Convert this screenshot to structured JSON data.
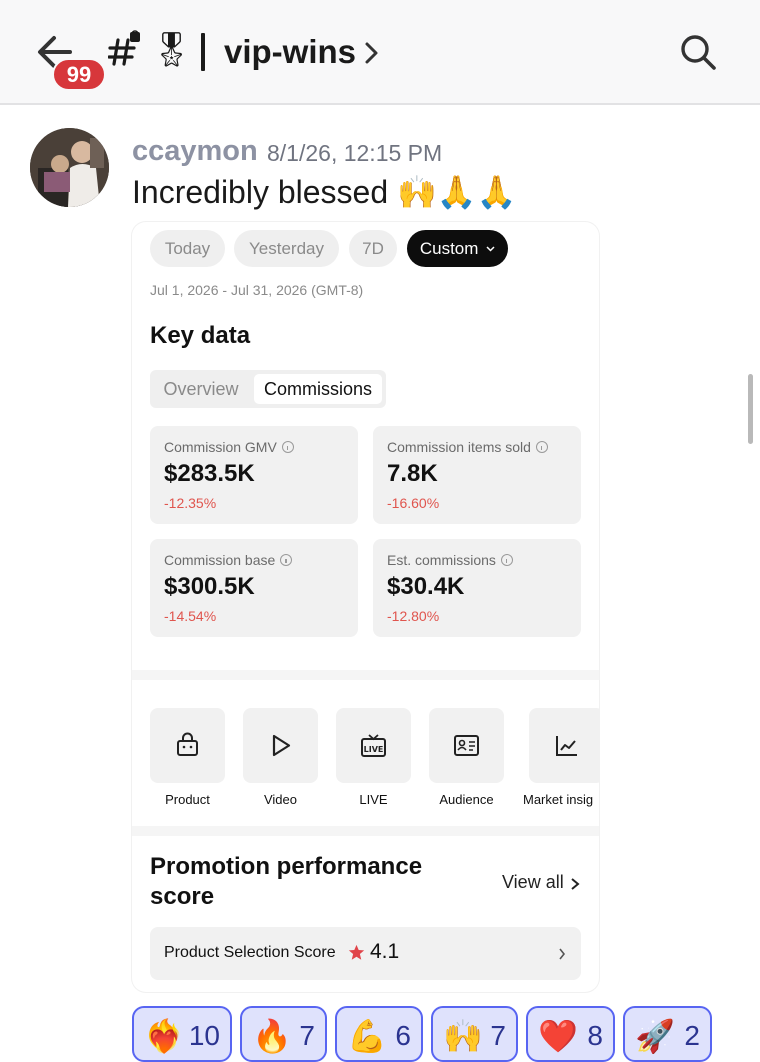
{
  "header": {
    "unread_count": "99",
    "channel_emoji": "🎖",
    "channel_name": "vip-wins",
    "icons": [
      "back-arrow-icon",
      "channel-hash-icon",
      "chevron-right-icon",
      "search-icon"
    ]
  },
  "message": {
    "username": "ccaymon",
    "timestamp": "8/1/26, 12:15 PM",
    "text": "Incredibly blessed 🙌🙏🙏"
  },
  "card": {
    "filters": [
      "Today",
      "Yesterday",
      "7D",
      "Custom"
    ],
    "selected_filter": "Custom",
    "date_range": "Jul 1, 2026 - Jul 31, 2026 (GMT-8)",
    "key_data_title": "Key data",
    "segments": [
      "Overview",
      "Commissions"
    ],
    "selected_segment": "Commissions",
    "stats": [
      {
        "label": "Commission GMV",
        "value": "$283.5K",
        "change": "-12.35%"
      },
      {
        "label": "Commission items sold",
        "value": "7.8K",
        "change": "-16.60%"
      },
      {
        "label": "Commission base",
        "value": "$300.5K",
        "change": "-14.54%"
      },
      {
        "label": "Est. commissions",
        "value": "$30.4K",
        "change": "-12.80%"
      }
    ],
    "tools": [
      {
        "label": "Product",
        "icon": "shopping-bag-icon"
      },
      {
        "label": "Video",
        "icon": "play-icon"
      },
      {
        "label": "LIVE",
        "icon": "live-tv-icon"
      },
      {
        "label": "Audience",
        "icon": "id-card-icon"
      },
      {
        "label": "Market insig",
        "icon": "line-chart-icon"
      }
    ],
    "promo_title": "Promotion performance score",
    "view_all": "View all",
    "score_label": "Product Selection Score",
    "score_value": "4.1"
  },
  "reactions": [
    {
      "emoji": "❤️‍🔥",
      "count": "10"
    },
    {
      "emoji": "🔥",
      "count": "7"
    },
    {
      "emoji": "💪",
      "count": "6"
    },
    {
      "emoji": "🙌",
      "count": "7"
    },
    {
      "emoji": "❤️",
      "count": "8"
    },
    {
      "emoji": "🚀",
      "count": "2"
    }
  ],
  "colors": {
    "badge_red": "#d7373b",
    "reaction_border": "#5865f2",
    "reaction_bg": "#dfe2fc",
    "negative_change": "#e0554e",
    "star": "#e0444a"
  }
}
